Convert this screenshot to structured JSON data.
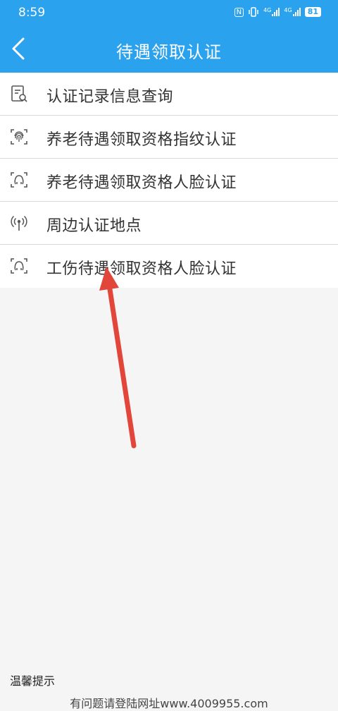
{
  "status": {
    "time": "8:59",
    "nfc": "N",
    "net1": "4G",
    "net2": "4G",
    "battery": "81"
  },
  "header": {
    "title": "待遇领取认证"
  },
  "menu": {
    "items": [
      {
        "label": "认证记录信息查询",
        "icon": "record-search-icon"
      },
      {
        "label": "养老待遇领取资格指纹认证",
        "icon": "fingerprint-icon"
      },
      {
        "label": "养老待遇领取资格人脸认证",
        "icon": "face-icon"
      },
      {
        "label": "周边认证地点",
        "icon": "location-signal-icon"
      },
      {
        "label": "工伤待遇领取资格人脸认证",
        "icon": "face-icon"
      }
    ]
  },
  "footer": {
    "tip_label": "温馨提示",
    "watermark": "有问题请登陆网址www.4009955.com"
  },
  "colors": {
    "primary": "#2aa2ee",
    "annotation_arrow": "#e2463a"
  }
}
